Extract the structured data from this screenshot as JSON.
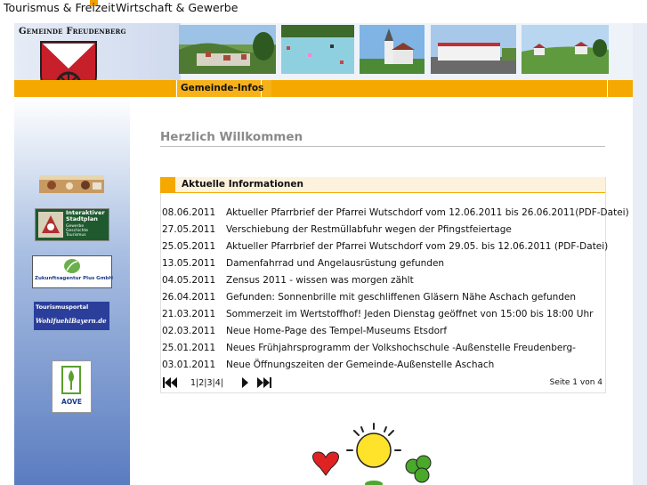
{
  "topnav": {
    "items": [
      "Tourismus & Freizeit",
      "Wirtschaft & Gewerbe"
    ]
  },
  "header": {
    "municipality": "Gemeinde Freudenberg",
    "photos": [
      "village-panorama",
      "swimming-pool",
      "church",
      "industrial-building",
      "countryside"
    ]
  },
  "nav": {
    "active": "Gemeinde-Infos"
  },
  "sidebar": {
    "logos": [
      {
        "name": "banner-photo-logo",
        "text": ""
      },
      {
        "name": "stadtplan-logo",
        "text": "Interaktiver Stadtplan",
        "sub": "Gewerbe Geschichte Tourismus"
      },
      {
        "name": "zukunftsagentur-logo",
        "text": "Zukunftsagentur Plus GmbH"
      },
      {
        "name": "tourismusportal-logo",
        "text": "Tourismusportal",
        "sub": "WohlfuehlBayern.de"
      },
      {
        "name": "aove-logo",
        "text": "AOVE"
      }
    ]
  },
  "main": {
    "welcome": "Herzlich Willkommen",
    "news_title": "Aktuelle Informationen",
    "news": [
      {
        "date": "08.06.2011",
        "text": "Aktueller Pfarrbrief der Pfarrei Wutschdorf vom 12.06.2011 bis 26.06.2011(PDF-Datei)"
      },
      {
        "date": "27.05.2011",
        "text": "Verschiebung der Restmüllabfuhr wegen der Pfingstfeiertage"
      },
      {
        "date": "25.05.2011",
        "text": "Aktueller Pfarrbrief der Pfarrei Wutschdorf vom 29.05. bis 12.06.2011 (PDF-Datei)"
      },
      {
        "date": "13.05.2011",
        "text": "Damenfahrrad und Angelausrüstung gefunden"
      },
      {
        "date": "04.05.2011",
        "text": "Zensus 2011 - wissen was morgen zählt"
      },
      {
        "date": "26.04.2011",
        "text": "Gefunden: Sonnenbrille mit geschliffenen Gläsern Nähe Aschach gefunden"
      },
      {
        "date": "21.03.2011",
        "text": "Sommerzeit im Wertstoffhof! Jeden Dienstag geöffnet von 15:00 bis 18:00 Uhr"
      },
      {
        "date": "02.03.2011",
        "text": "Neue Home-Page des Tempel-Museums Etsdorf"
      },
      {
        "date": "25.01.2011",
        "text": "Neues Frühjahrsprogramm der Volkshochschule -Außenstelle Freudenberg-"
      },
      {
        "date": "03.01.2011",
        "text": "Neue Öffnungszeiten der Gemeinde-Außenstelle Aschach"
      }
    ],
    "pager": {
      "pages": "1|2|3|4|",
      "info": "Seite 1 von 4"
    }
  },
  "colors": {
    "accent": "#f5a800",
    "sidebar_dark": "#5a7cc0",
    "welcome_text": "#8a8a8a"
  }
}
